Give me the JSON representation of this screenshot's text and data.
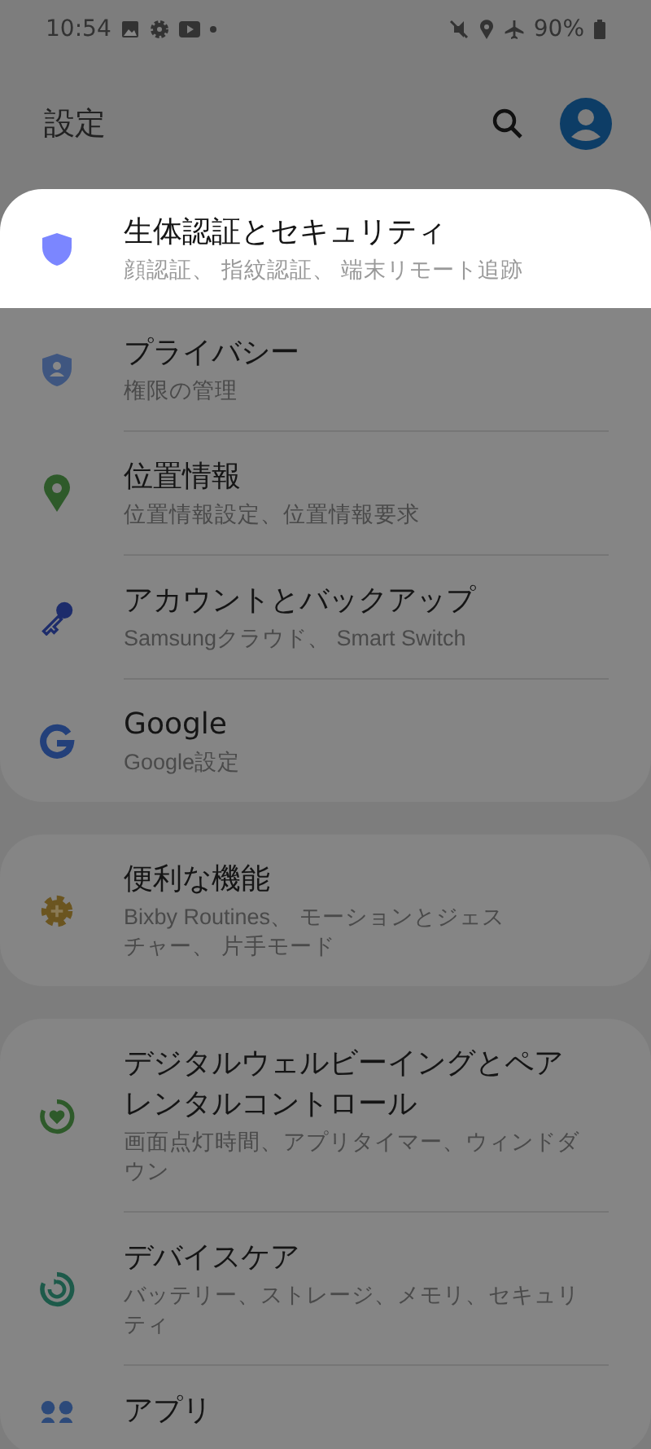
{
  "status_bar": {
    "time": "10:54",
    "battery": "90%"
  },
  "header": {
    "title": "設定"
  },
  "groups": [
    {
      "items": [
        {
          "kind": "shield",
          "title": [
            "生体認証とセキュリティ"
          ],
          "subtitle": [
            "顔認証、 指紋認証、 端末リモート追跡"
          ],
          "highlighted": true
        },
        {
          "kind": "privacy",
          "title": [
            "プライバシー"
          ],
          "subtitle": [
            "権限の管理"
          ],
          "highlighted": false
        },
        {
          "kind": "location",
          "title": [
            "位置情報"
          ],
          "subtitle": [
            "位置情報設定、位置情報要求"
          ],
          "highlighted": false
        },
        {
          "kind": "account",
          "title": [
            "アカウントとバックアップ"
          ],
          "subtitle": [
            "Samsungクラウド、 Smart Switch"
          ],
          "highlighted": false
        },
        {
          "kind": "google",
          "title": [
            "Google"
          ],
          "subtitle": [
            "Google設定"
          ],
          "highlighted": false
        }
      ]
    },
    {
      "items": [
        {
          "kind": "features",
          "title": [
            "便利な機能"
          ],
          "subtitle": [
            "Bixby Routines、 モーションとジェス",
            "チャー、 片手モード"
          ],
          "highlighted": false
        }
      ]
    },
    {
      "items": [
        {
          "kind": "wellbeing",
          "title": [
            "デジタルウェルビーイングとペア",
            "レンタルコントロール"
          ],
          "subtitle": [
            "画面点灯時間、アプリタイマー、ウィンドダ",
            "ウン"
          ],
          "highlighted": false
        },
        {
          "kind": "care",
          "title": [
            "デバイスケア"
          ],
          "subtitle": [
            "バッテリー、ストレージ、メモリ、セキュリ",
            "ティ"
          ],
          "highlighted": false
        },
        {
          "kind": "apps",
          "title": [
            "アプリ"
          ],
          "highlighted": false
        }
      ]
    }
  ]
}
